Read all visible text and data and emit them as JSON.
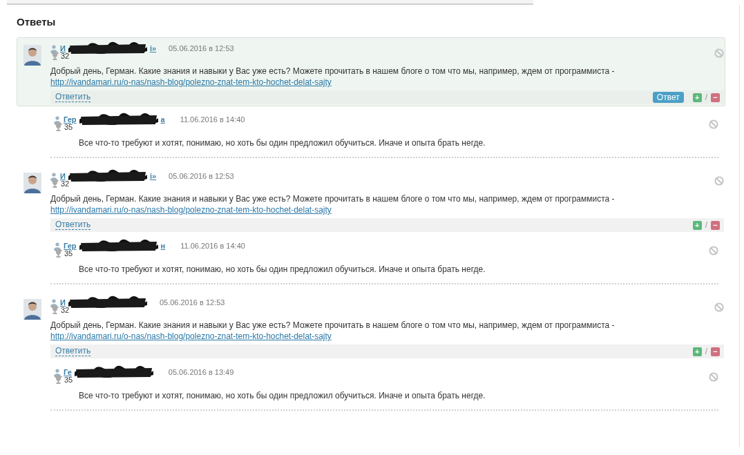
{
  "heading": "Ответы",
  "threads": [
    {
      "answer": {
        "name_start": "И",
        "name_end": "i»",
        "date": "05.06.2016 в 12:53",
        "score": "32",
        "text": "Добрый день, Герман. Какие знания и навыки у Вас уже есть? Можете прочитать в нашем блоге о том что мы, например, ждем от программиста - ",
        "link": "http://ivandamari.ru/o-nas/nash-blog/polezno-znat-tem-kto-hochet-delat-sajty",
        "highlighted": true,
        "badge": "Ответ",
        "reply": "Ответить",
        "plus": "+",
        "sep": "/",
        "minus": "−"
      },
      "reply": {
        "name_start": "Гер",
        "name_end": "а",
        "date": "11.06.2016 в 14:40",
        "score": "35",
        "text": "Все что-то требуют и хотят, понимаю, но хоть бы один предложил обучиться. Иначе и опыта брать негде."
      }
    },
    {
      "answer": {
        "name_start": "И",
        "name_end": "i»",
        "date": "05.06.2016 в 12:53",
        "score": "32",
        "text": "Добрый день, Герман. Какие знания и навыки у Вас уже есть? Можете прочитать в нашем блоге о том что мы, например, ждем от программиста - ",
        "link": "http://ivandamari.ru/o-nas/nash-blog/polezno-znat-tem-kto-hochet-delat-sajty",
        "highlighted": false,
        "reply": "Ответить",
        "plus": "+",
        "sep": "/",
        "minus": "−"
      },
      "reply": {
        "name_start": "Гер",
        "name_end": "н",
        "date": "11.06.2016 в 14:40",
        "score": "35",
        "text": "Все что-то требуют и хотят, понимаю, но хоть бы один предложил обучиться. Иначе и опыта брать негде."
      }
    },
    {
      "answer": {
        "name_start": "И",
        "date": "05.06.2016 в 12:53",
        "score": "32",
        "text": "Добрый день, Герман. Какие знания и навыки у Вас уже есть? Можете прочитать в нашем блоге о том что мы, например, ждем от программиста - ",
        "link": "http://ivandamari.ru/o-nas/nash-blog/polezno-znat-tem-kto-hochet-delat-sajty",
        "highlighted": false,
        "reply": "Ответить",
        "plus": "+",
        "sep": "/",
        "minus": "−"
      },
      "reply": {
        "name_start": "Ге",
        "date": "05.06.2016 в 13:49",
        "score": "35",
        "text": "Все что-то требуют и хотят, понимаю, но хоть бы один предложил обучиться. Иначе и опыта брать негде."
      }
    }
  ]
}
